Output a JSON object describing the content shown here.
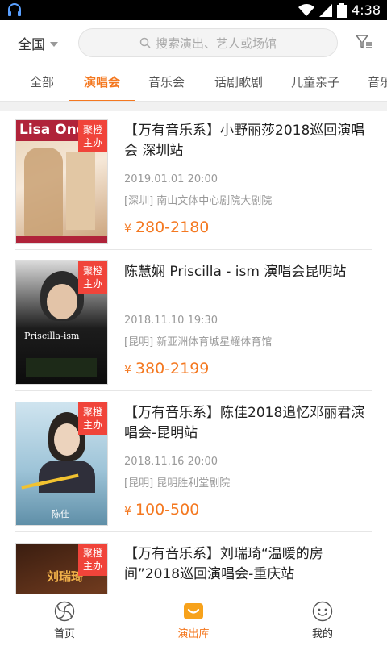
{
  "status_bar": {
    "time": "4:38"
  },
  "header": {
    "city": "全国",
    "search_placeholder": "搜索演出、艺人或场馆"
  },
  "tabs": [
    {
      "label": "全部"
    },
    {
      "label": "演唱会"
    },
    {
      "label": "音乐会"
    },
    {
      "label": "话剧歌剧"
    },
    {
      "label": "儿童亲子"
    },
    {
      "label": "音乐"
    }
  ],
  "active_tab": 1,
  "events": [
    {
      "title": "【万有音乐系】小野丽莎2018巡回演唱会 深圳站",
      "datetime": "2019.01.01 20:00",
      "venue": "[深圳] 南山文体中心剧院大剧院",
      "price": "280-2180",
      "badge": "聚橙\n主办",
      "poster_text": "Lisa Ono"
    },
    {
      "title": "陈慧娴 Priscilla - ism 演唱会昆明站",
      "datetime": "2018.11.10 19:30",
      "venue": "[昆明] 新亚洲体育城星耀体育馆",
      "price": "380-2199",
      "badge": "聚橙\n主办",
      "poster_text": "Priscilla-ism"
    },
    {
      "title": "【万有音乐系】陈佳2018追忆邓丽君演唱会-昆明站",
      "datetime": "2018.11.16 20:00",
      "venue": "[昆明] 昆明胜利堂剧院",
      "price": "100-500",
      "badge": "聚橙\n主办",
      "poster_text": "陈佳"
    },
    {
      "title": "【万有音乐系】刘瑞琦“温暖的房间”2018巡回演唱会-重庆站",
      "datetime": "",
      "venue": "",
      "price": "",
      "badge": "聚橙\n主办",
      "poster_text": "刘瑞琦"
    }
  ],
  "currency_symbol": "¥",
  "bottom_nav": [
    {
      "label": "首页",
      "icon": "pinwheel-icon"
    },
    {
      "label": "演出库",
      "icon": "ticket-smile-icon"
    },
    {
      "label": "我的",
      "icon": "smiley-face-icon"
    }
  ],
  "active_nav": 1,
  "colors": {
    "accent": "#f47820",
    "badge": "#f0443a"
  }
}
